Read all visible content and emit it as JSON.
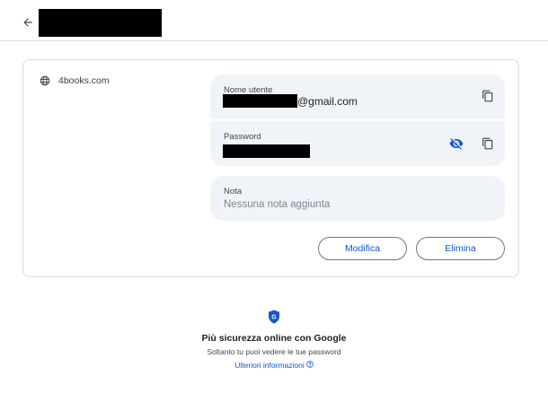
{
  "header": {
    "back_icon": "arrow-back-icon"
  },
  "entry": {
    "site_icon": "globe-icon",
    "site": "4books.com",
    "username_label": "Nome utente",
    "username_suffix": "@gmail.com",
    "password_label": "Password",
    "note_label": "Nota",
    "note_placeholder": "Nessuna nota aggiunta",
    "copy_icon": "copy-icon",
    "visibility_icon": "visibility-off-icon"
  },
  "actions": {
    "edit_label": "Modifica",
    "delete_label": "Elimina"
  },
  "footer": {
    "shield_icon": "google-shield-icon",
    "shield_letter": "G",
    "title": "Più sicurezza online con Google",
    "subtitle": "Soltanto tu puoi vedere le tue password",
    "link_label": "Ulteriori informazioni",
    "link_icon": "help-circle-icon"
  },
  "colors": {
    "accent": "#0b57d0",
    "field_bg": "#f0f4f9",
    "border": "#dadce0"
  }
}
